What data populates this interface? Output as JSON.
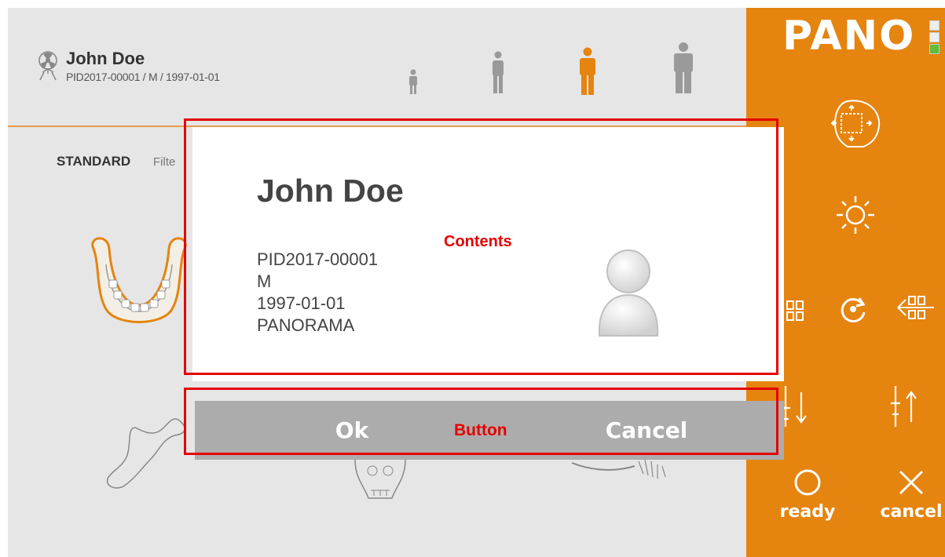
{
  "header": {
    "patient_name": "John Doe",
    "patient_info": "PID2017-00001 / M / 1997-01-01"
  },
  "size_selector": [
    {
      "name": "child",
      "color": "#9a9a9a"
    },
    {
      "name": "small-adult",
      "color": "#9a9a9a"
    },
    {
      "name": "medium-adult",
      "color": "#e5840f"
    },
    {
      "name": "large-adult",
      "color": "#9a9a9a"
    }
  ],
  "program": {
    "mode_label": "STANDARD",
    "filter_label": "Filte"
  },
  "right_panel": {
    "title": "PANO",
    "accent_color": "#e5840f",
    "status_leds": [
      "off",
      "off",
      "on"
    ],
    "ready_label": "ready",
    "cancel_label": "cancel"
  },
  "dialog": {
    "name": "John Doe",
    "pid": "PID2017-00001",
    "sex": "M",
    "dob": "1997-01-01",
    "mode": "PANORAMA",
    "contents_annotation": "Contents",
    "ok_label": "Ok",
    "button_annotation": "Button",
    "cancel_label": "Cancel",
    "annotation_color": "#e50000"
  }
}
